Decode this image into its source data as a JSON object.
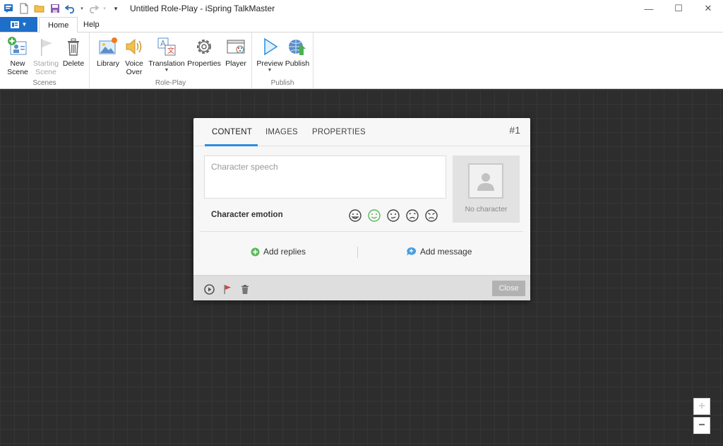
{
  "window": {
    "title": "Untitled Role-Play - iSpring TalkMaster",
    "controls": {
      "minimize": "—",
      "maximize": "☐",
      "close": "✕"
    }
  },
  "menu": {
    "tabs": [
      {
        "label": "Home",
        "active": true
      },
      {
        "label": "Help",
        "active": false
      }
    ]
  },
  "ribbon": {
    "groups": [
      {
        "label": "Scenes",
        "buttons": [
          {
            "line1": "New",
            "line2": "Scene",
            "icon": "new-scene-icon"
          },
          {
            "line1": "Starting",
            "line2": "Scene",
            "icon": "flag-icon",
            "disabled": true
          },
          {
            "line1": "Delete",
            "line2": "",
            "icon": "trash-icon"
          }
        ]
      },
      {
        "label": "Role-Play",
        "buttons": [
          {
            "line1": "Library",
            "icon": "library-icon"
          },
          {
            "line1": "Voice",
            "line2": "Over",
            "icon": "speaker-icon"
          },
          {
            "line1": "Translation",
            "icon": "translation-icon",
            "dropdown": true
          },
          {
            "line1": "Properties",
            "icon": "gear-icon"
          },
          {
            "line1": "Player",
            "icon": "player-icon"
          }
        ]
      },
      {
        "label": "Publish",
        "buttons": [
          {
            "line1": "Preview",
            "icon": "play-icon",
            "dropdown": true
          },
          {
            "line1": "Publish",
            "icon": "globe-upload-icon"
          }
        ]
      }
    ]
  },
  "dialog": {
    "tabs": [
      {
        "label": "CONTENT",
        "active": true
      },
      {
        "label": "IMAGES",
        "active": false
      },
      {
        "label": "PROPERTIES",
        "active": false
      }
    ],
    "scene_number": "#1",
    "speech_placeholder": "Character speech",
    "emotion_label": "Character emotion",
    "emotions": [
      "happy",
      "neutral-selected",
      "neutral",
      "sad",
      "angry"
    ],
    "selected_emotion_color": "#5cb85c",
    "avatar_label": "No character",
    "add_replies": "Add replies",
    "add_message": "Add message",
    "close_label": "Close"
  },
  "zoom": {
    "in": "+",
    "out": "−"
  },
  "colors": {
    "accent": "#2d8de0",
    "file_button": "#1e6fc9",
    "add_green": "#5cb85c",
    "flag_red": "#d9433a"
  }
}
